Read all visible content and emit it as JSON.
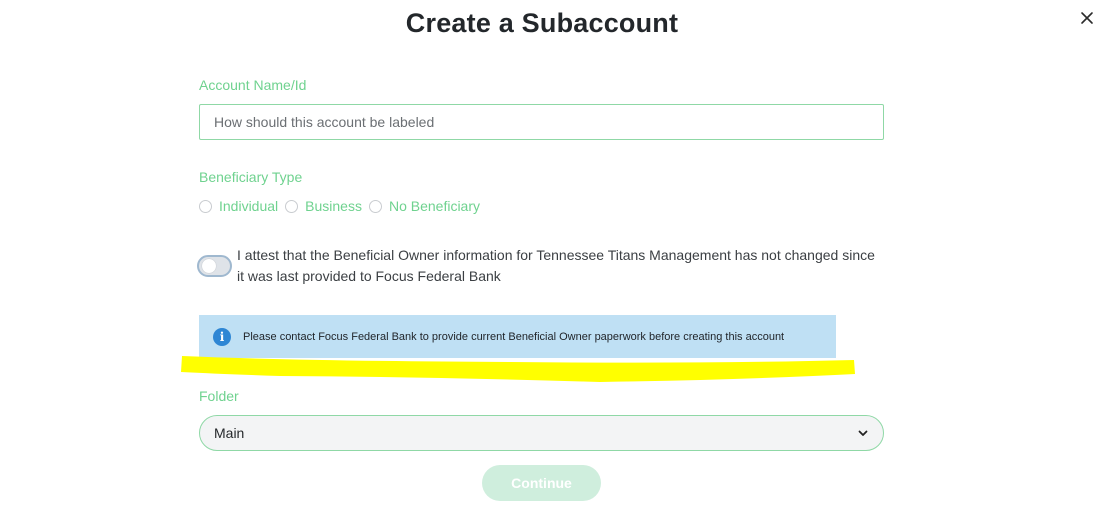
{
  "dialog": {
    "title": "Create a Subaccount",
    "close_icon": "close-icon"
  },
  "account_name": {
    "label": "Account Name/Id",
    "value": "",
    "placeholder": "How should this account be labeled"
  },
  "beneficiary_type": {
    "label": "Beneficiary Type",
    "options": [
      {
        "label": "Individual",
        "selected": false
      },
      {
        "label": "Business",
        "selected": false
      },
      {
        "label": "No Beneficiary",
        "selected": false
      }
    ]
  },
  "attestation": {
    "enabled": false,
    "text": "I attest that the Beneficial Owner information for Tennessee Titans Management has not changed since it was last provided to Focus Federal Bank"
  },
  "info_banner": {
    "icon": "info-icon",
    "text": "Please contact Focus Federal Bank to provide current Beneficial Owner paperwork before creating this account"
  },
  "folder": {
    "label": "Folder",
    "value": "Main",
    "icon": "chevron-down-icon"
  },
  "actions": {
    "continue_label": "Continue"
  },
  "colors": {
    "accent": "#6fd28f",
    "banner_bg": "#bfe0f4",
    "highlight": "#ffff00",
    "continue_disabled_bg": "#cfeedd"
  }
}
